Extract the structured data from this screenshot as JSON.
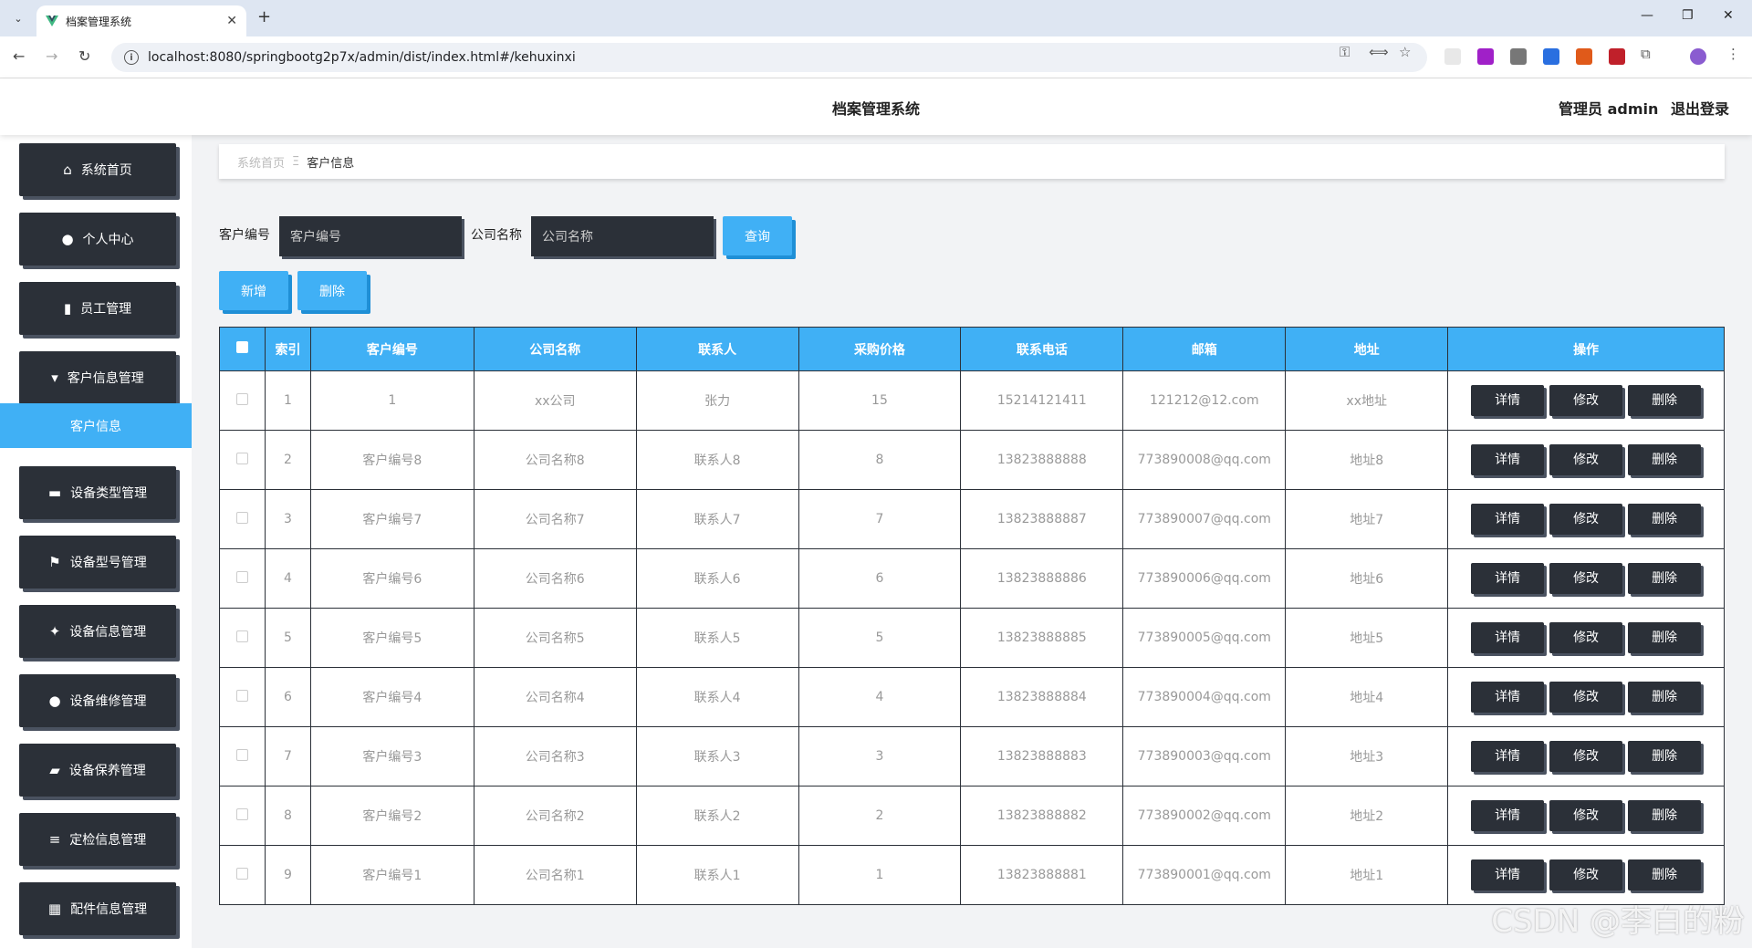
{
  "browser": {
    "tab_title": "档案管理系统",
    "url": "localhost:8080/springbootg2p7x/admin/dist/index.html#/kehuxinxi"
  },
  "header": {
    "title": "档案管理系统",
    "user_label": "管理员 admin",
    "logout_label": "退出登录"
  },
  "sidebar": {
    "items": [
      {
        "label": "系统首页",
        "icon": "home-icon"
      },
      {
        "label": "个人中心",
        "icon": "user-icon"
      },
      {
        "label": "员工管理",
        "icon": "book-icon"
      },
      {
        "label": "客户信息管理",
        "icon": "sign-icon"
      },
      {
        "label": "设备类型管理",
        "icon": "printer-icon"
      },
      {
        "label": "设备型号管理",
        "icon": "flag-icon"
      },
      {
        "label": "设备信息管理",
        "icon": "thumbs-up-icon"
      },
      {
        "label": "设备维修管理",
        "icon": "user-icon"
      },
      {
        "label": "设备保养管理",
        "icon": "ticket-icon"
      },
      {
        "label": "定检信息管理",
        "icon": "list-icon"
      },
      {
        "label": "配件信息管理",
        "icon": "grid-icon"
      }
    ],
    "active_sub": "客户信息"
  },
  "breadcrumb": {
    "home": "系统首页",
    "separator": "Ξ",
    "current": "客户信息"
  },
  "search": {
    "customer_no_label": "客户编号",
    "customer_no_placeholder": "客户编号",
    "company_label": "公司名称",
    "company_placeholder": "公司名称",
    "query_button": "查询"
  },
  "actions": {
    "add": "新增",
    "delete": "删除"
  },
  "table": {
    "columns": [
      "索引",
      "客户编号",
      "公司名称",
      "联系人",
      "采购价格",
      "联系电话",
      "邮箱",
      "地址",
      "操作"
    ],
    "rows": [
      {
        "index": "1",
        "no": "1",
        "company": "xx公司",
        "contact": "张力",
        "price": "15",
        "phone": "15214121411",
        "email": "121212@12.com",
        "address": "xx地址"
      },
      {
        "index": "2",
        "no": "客户编号8",
        "company": "公司名称8",
        "contact": "联系人8",
        "price": "8",
        "phone": "13823888888",
        "email": "773890008@qq.com",
        "address": "地址8"
      },
      {
        "index": "3",
        "no": "客户编号7",
        "company": "公司名称7",
        "contact": "联系人7",
        "price": "7",
        "phone": "13823888887",
        "email": "773890007@qq.com",
        "address": "地址7"
      },
      {
        "index": "4",
        "no": "客户编号6",
        "company": "公司名称6",
        "contact": "联系人6",
        "price": "6",
        "phone": "13823888886",
        "email": "773890006@qq.com",
        "address": "地址6"
      },
      {
        "index": "5",
        "no": "客户编号5",
        "company": "公司名称5",
        "contact": "联系人5",
        "price": "5",
        "phone": "13823888885",
        "email": "773890005@qq.com",
        "address": "地址5"
      },
      {
        "index": "6",
        "no": "客户编号4",
        "company": "公司名称4",
        "contact": "联系人4",
        "price": "4",
        "phone": "13823888884",
        "email": "773890004@qq.com",
        "address": "地址4"
      },
      {
        "index": "7",
        "no": "客户编号3",
        "company": "公司名称3",
        "contact": "联系人3",
        "price": "3",
        "phone": "13823888883",
        "email": "773890003@qq.com",
        "address": "地址3"
      },
      {
        "index": "8",
        "no": "客户编号2",
        "company": "公司名称2",
        "contact": "联系人2",
        "price": "2",
        "phone": "13823888882",
        "email": "773890002@qq.com",
        "address": "地址2"
      },
      {
        "index": "9",
        "no": "客户编号1",
        "company": "公司名称1",
        "contact": "联系人1",
        "price": "1",
        "phone": "13823888881",
        "email": "773890001@qq.com",
        "address": "地址1"
      }
    ],
    "op_labels": {
      "detail": "详情",
      "edit": "修改",
      "delete": "删除"
    }
  },
  "watermark": "CSDN @李白的粉",
  "colors": {
    "accent": "#40b0f5",
    "dark": "#2b3038"
  }
}
